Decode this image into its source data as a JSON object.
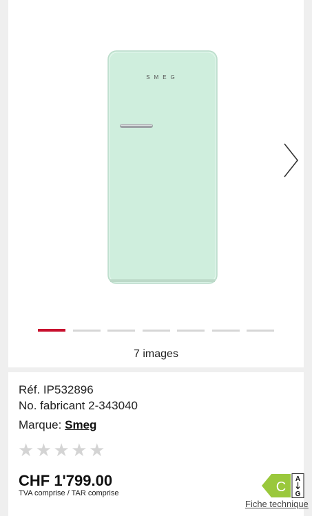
{
  "gallery": {
    "image_count_label": "7 images",
    "brand_logo_text": "SMEG",
    "total_images": 7,
    "active_index": 0,
    "accent_color": "#c8102e",
    "fridge_color": "#cfeedd"
  },
  "product": {
    "ref_label": "Réf.",
    "ref_value": "IP532896",
    "manufacturer_label": "No. fabricant",
    "manufacturer_value": "2-343040",
    "brand_label": "Marque:",
    "brand_value": "Smeg",
    "rating": 0,
    "rating_max": 5,
    "price": "CHF 1'799.00",
    "vat_note": "TVA comprise / TAR comprise"
  },
  "energy": {
    "class": "C",
    "scale_top": "A",
    "scale_bottom": "G",
    "color": "#9ac83c",
    "fiche_label": "Fiche technique"
  }
}
